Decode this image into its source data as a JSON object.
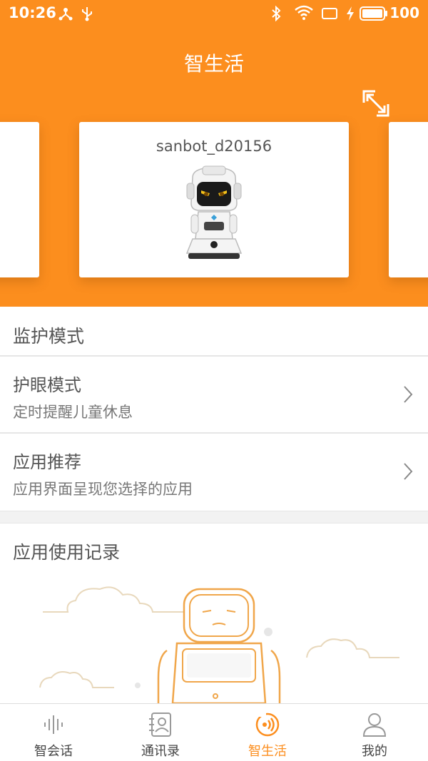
{
  "status_bar": {
    "time": "10:26",
    "battery": "100",
    "icons": [
      "usb-share-icon",
      "usb-icon",
      "bluetooth-icon",
      "wifi-icon",
      "screen-icon",
      "charging-icon",
      "battery-icon"
    ]
  },
  "header": {
    "title": "智生活",
    "expand_icon": "expand-icon"
  },
  "carousel": {
    "active_device": "sanbot_d20156"
  },
  "monitor_section": {
    "title": "监护模式",
    "rows": [
      {
        "title": "护眼模式",
        "subtitle": "定时提醒儿童休息"
      },
      {
        "title": "应用推荐",
        "subtitle": "应用界面呈现您选择的应用"
      }
    ]
  },
  "usage_section": {
    "title": "应用使用记录"
  },
  "tabbar": {
    "tabs": [
      {
        "label": "智会话",
        "icon": "voice-wave-icon"
      },
      {
        "label": "通讯录",
        "icon": "contacts-icon"
      },
      {
        "label": "智生活",
        "icon": "smart-life-icon"
      },
      {
        "label": "我的",
        "icon": "profile-icon"
      }
    ],
    "active_index": 2
  },
  "colors": {
    "accent": "#fc8e1e",
    "text": "#555555",
    "divider": "#e6e6e6"
  }
}
